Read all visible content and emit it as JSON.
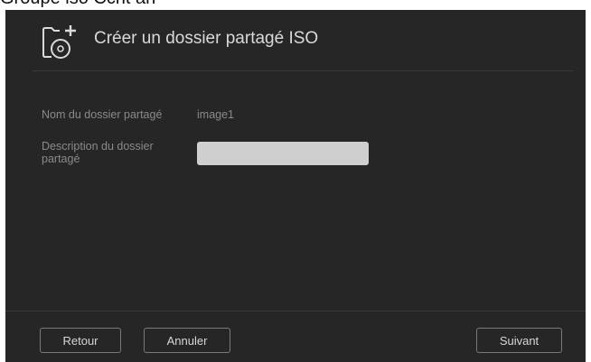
{
  "partial_top_text": "Groupe iso Ccrit an",
  "dialog": {
    "title": "Créer un dossier partagé ISO",
    "header_icon": "folder-disc-plus-icon"
  },
  "form": {
    "name_label": "Nom du dossier partagé",
    "name_value": "image1",
    "description_label": "Description du dossier partagé",
    "description_value": ""
  },
  "footer": {
    "back_label": "Retour",
    "cancel_label": "Annuler",
    "next_label": "Suivant"
  },
  "colors": {
    "dialog_bg": "#262626",
    "title_text": "#d9d9d9",
    "label_text": "#8a8a8a",
    "input_bg": "#cfcfcf",
    "button_border": "#7a7a7a"
  }
}
